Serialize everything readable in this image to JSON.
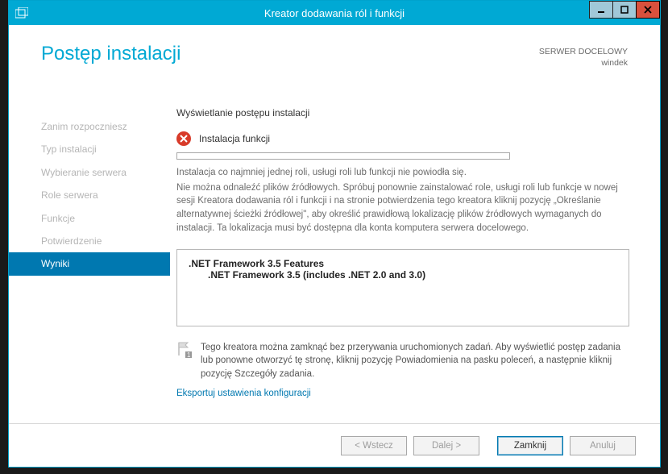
{
  "titlebar": {
    "title": "Kreator dodawania ról i funkcji"
  },
  "header": {
    "page_title": "Postęp instalacji",
    "server_label": "SERWER DOCELOWY",
    "server_name": "windek"
  },
  "nav": {
    "items": [
      "Zanim rozpoczniesz",
      "Typ instalacji",
      "Wybieranie serwera",
      "Role serwera",
      "Funkcje",
      "Potwierdzenie",
      "Wyniki"
    ],
    "active_index": 6
  },
  "main": {
    "view_label": "Wyświetlanie postępu instalacji",
    "status_text": "Instalacja funkcji",
    "error_line1": "Instalacja co najmniej jednej roli, usługi roli lub funkcji nie powiodła się.",
    "error_line2": "Nie można odnaleźć plików źródłowych. Spróbuj ponownie zainstalować role, usługi roli lub funkcje w nowej sesji Kreatora dodawania ról i funkcji i na stronie potwierdzenia tego kreatora kliknij pozycję „Określanie alternatywnej ścieżki źródłowej\", aby określić prawidłową lokalizację plików źródłowych wymaganych do instalacji. Ta lokalizacja musi być dostępna dla konta komputera serwera docelowego.",
    "feature_parent": ".NET Framework 3.5 Features",
    "feature_child": ".NET Framework 3.5 (includes .NET 2.0 and 3.0)",
    "note_text": "Tego kreatora można zamknąć bez przerywania uruchomionych zadań. Aby wyświetlić postęp zadania lub ponowne otworzyć tę stronę, kliknij pozycję Powiadomienia na pasku poleceń, a następnie kliknij pozycję Szczegóły zadania.",
    "export_link": "Eksportuj ustawienia konfiguracji"
  },
  "footer": {
    "back": "< Wstecz",
    "next": "Dalej >",
    "close": "Zamknij",
    "cancel": "Anuluj"
  }
}
